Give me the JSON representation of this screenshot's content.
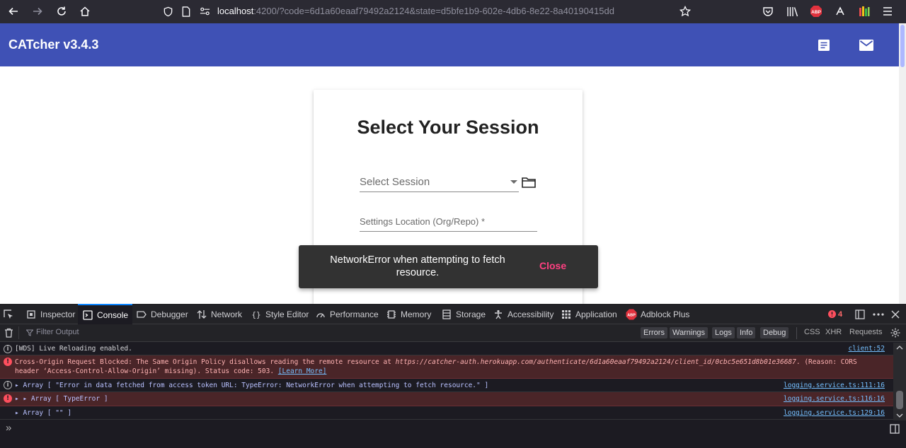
{
  "browser": {
    "url_host": "localhost",
    "url_rest": ":4200/?code=6d1a60eaaf79492a2124&state=d5bfe1b9-602e-4db6-8e22-8a40190415dd",
    "abp_badge": "ABP"
  },
  "app": {
    "title": "CATcher v3.4.3",
    "accent_color": "#3f51b5"
  },
  "session_card": {
    "title": "Select Your Session",
    "select_value": "Select Session",
    "settings_placeholder": "Settings Location (Org/Repo) *"
  },
  "snackbar": {
    "message_line1": "NetworkError when attempting to fetch",
    "message_line2": "resource.",
    "close_label": "Close",
    "close_color": "#ff4081"
  },
  "devtools": {
    "tabs": [
      "Inspector",
      "Console",
      "Debugger",
      "Network",
      "Style Editor",
      "Performance",
      "Memory",
      "Storage",
      "Accessibility",
      "Application",
      "Adblock Plus"
    ],
    "active_tab": "Console",
    "error_count": "4",
    "filter_placeholder": "Filter Output",
    "level_filters": [
      "Errors",
      "Warnings",
      "Logs",
      "Info",
      "Debug"
    ],
    "type_filters": [
      "CSS",
      "XHR",
      "Requests"
    ],
    "logs": [
      {
        "level": "info",
        "text": "[WDS] Live Reloading enabled.",
        "source": "client:52"
      },
      {
        "level": "error",
        "text_before_url": "Cross-Origin Request Blocked: The Same Origin Policy disallows reading the remote resource at ",
        "url": "https://catcher-auth.herokuapp.com/authenticate/6d1a60eaaf79492a2124/client_id/0cbc5e651d8b01e36687",
        "text_after_url": ". (Reason: CORS header ‘Access-Control-Allow-Origin’ missing). Status code: 503. ",
        "link": "[Learn More]"
      },
      {
        "level": "info",
        "text": "▸ Array [ \"Error in data fetched from access token URL: TypeError: NetworkError when attempting to fetch resource.\" ]",
        "source": "logging.service.ts:111:16"
      },
      {
        "level": "error",
        "text": "▸ ▸ Array [ TypeError ]",
        "source": "logging.service.ts:116:16"
      },
      {
        "level": "none",
        "text": "▸ Array [ \"\" ]",
        "source": "logging.service.ts:129:16"
      }
    ],
    "prompt": "»"
  }
}
